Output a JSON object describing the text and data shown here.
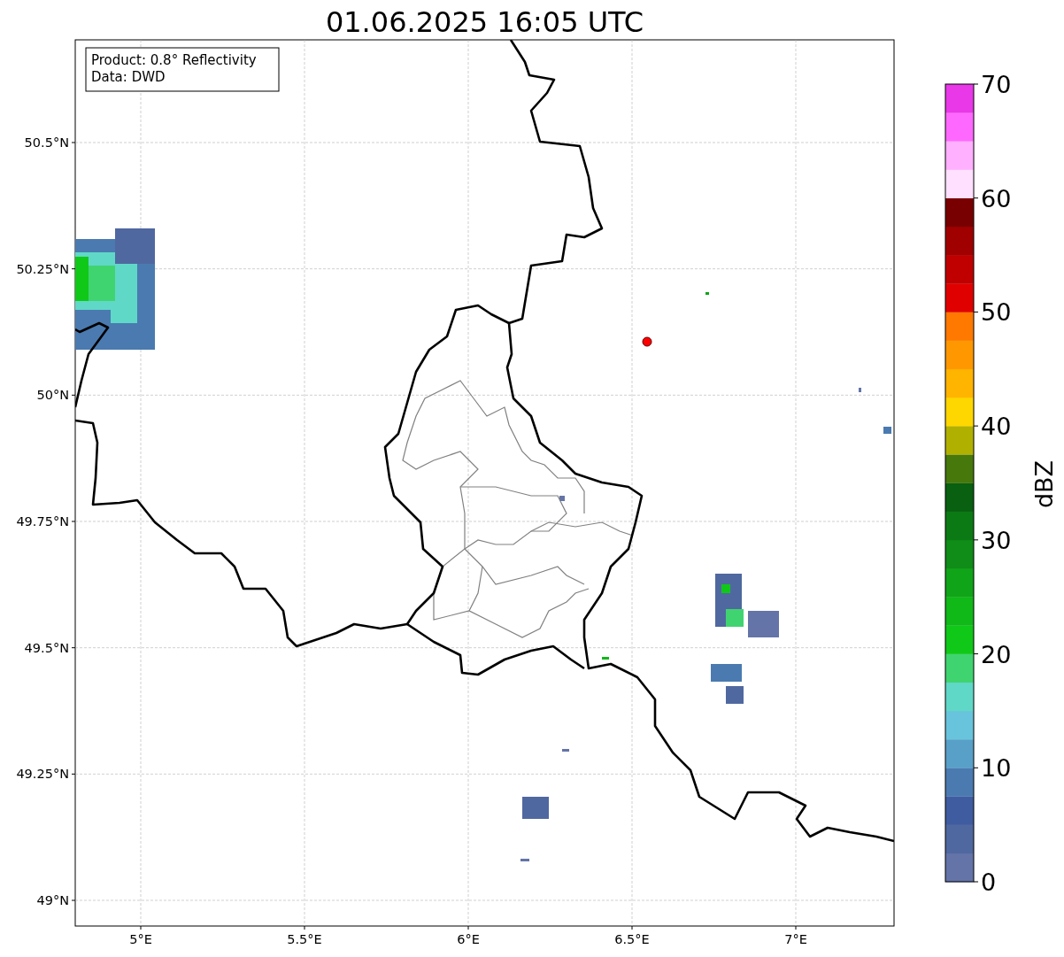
{
  "title": "01.06.2025 16:05 UTC",
  "legend": [
    "Product: 0.8° Reflectivity",
    "Data: DWD"
  ],
  "map": {
    "xticks": [
      "5°E",
      "5.5°E",
      "6°E",
      "6.5°E",
      "7°E"
    ],
    "yticks": [
      "50.5°N",
      "50.25°N",
      "50°N",
      "49.75°N",
      "49.5°N",
      "49.25°N",
      "49°N"
    ]
  },
  "colorbar": {
    "label": "dBZ",
    "ticks": [
      "70",
      "60",
      "50",
      "40",
      "30",
      "20",
      "10",
      "0"
    ],
    "bins": [
      {
        "color": "#6474a8"
      },
      {
        "color": "#5068a0"
      },
      {
        "color": "#405ca0"
      },
      {
        "color": "#4a7ab0"
      },
      {
        "color": "#58a0c8"
      },
      {
        "color": "#68c4dc"
      },
      {
        "color": "#60d8c8"
      },
      {
        "color": "#40d470"
      },
      {
        "color": "#10c818"
      },
      {
        "color": "#10b818"
      },
      {
        "color": "#10a418"
      },
      {
        "color": "#108c18"
      },
      {
        "color": "#0c7a14"
      },
      {
        "color": "#086010"
      },
      {
        "color": "#46780c"
      },
      {
        "color": "#b0b000"
      },
      {
        "color": "#ffd700"
      },
      {
        "color": "#ffb400"
      },
      {
        "color": "#ff9800"
      },
      {
        "color": "#ff7800"
      },
      {
        "color": "#e00000"
      },
      {
        "color": "#c00000"
      },
      {
        "color": "#a00000"
      },
      {
        "color": "#780000"
      },
      {
        "color": "#ffe0ff"
      },
      {
        "color": "#ffb0ff"
      },
      {
        "color": "#ff68ff"
      },
      {
        "color": "#e838e8"
      }
    ]
  }
}
